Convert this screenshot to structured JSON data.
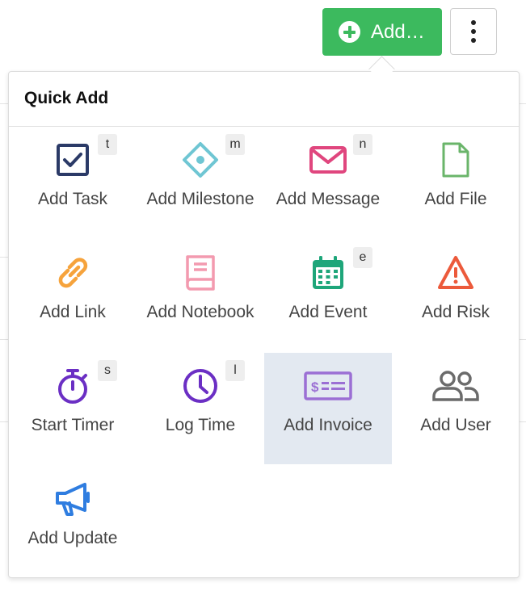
{
  "toolbar": {
    "add_label": "Add…",
    "plus_icon": "plus-circle-icon",
    "more_icon": "vertical-ellipsis-icon",
    "add_color": "#3cba5e"
  },
  "quick_add": {
    "title": "Quick Add",
    "items": [
      {
        "label": "Add Task",
        "shortcut": "t",
        "icon": "checkbox-icon",
        "color": "#2b3a67"
      },
      {
        "label": "Add Milestone",
        "shortcut": "m",
        "icon": "milestone-diamond-icon",
        "color": "#6fc6d3"
      },
      {
        "label": "Add Message",
        "shortcut": "n",
        "icon": "envelope-icon",
        "color": "#e0467e"
      },
      {
        "label": "Add File",
        "shortcut": "",
        "icon": "file-icon",
        "color": "#6ab56a"
      },
      {
        "label": "Add Link",
        "shortcut": "",
        "icon": "link-icon",
        "color": "#f6a33c"
      },
      {
        "label": "Add Notebook",
        "shortcut": "",
        "icon": "notebook-icon",
        "color": "#f39aaf"
      },
      {
        "label": "Add Event",
        "shortcut": "e",
        "icon": "calendar-icon",
        "color": "#1ea67a"
      },
      {
        "label": "Add Risk",
        "shortcut": "",
        "icon": "warning-triangle-icon",
        "color": "#ec5a3b"
      },
      {
        "label": "Start Timer",
        "shortcut": "s",
        "icon": "stopwatch-icon",
        "color": "#6b2fc4"
      },
      {
        "label": "Log Time",
        "shortcut": "l",
        "icon": "clock-icon",
        "color": "#6b2fc4"
      },
      {
        "label": "Add Invoice",
        "shortcut": "",
        "icon": "invoice-icon",
        "color": "#9b6fd4",
        "highlighted": true
      },
      {
        "label": "Add User",
        "shortcut": "",
        "icon": "users-icon",
        "color": "#6b6b6b"
      },
      {
        "label": "Add Update",
        "shortcut": "",
        "icon": "megaphone-icon",
        "color": "#2f7de0"
      }
    ]
  }
}
